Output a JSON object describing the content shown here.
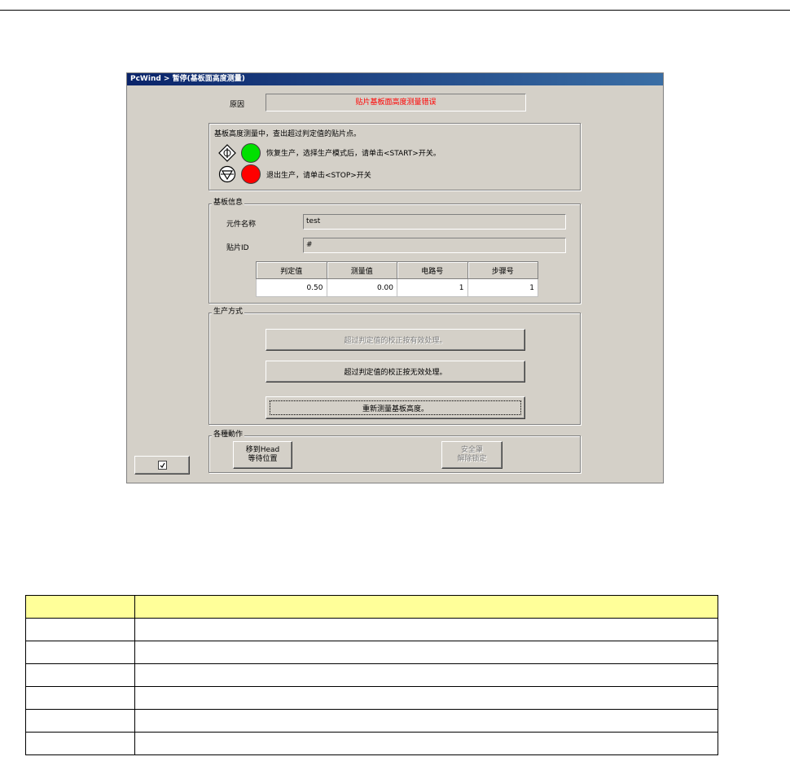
{
  "window": {
    "title": "PcWind > 暂停(基板面高度测量)"
  },
  "reason": {
    "label": "原因",
    "value": "贴片基板面高度测量错误"
  },
  "message": {
    "text": "基板高度测量中，查出超过判定值的贴片点。",
    "resume_text": "恢复生产，选择生产模式后，请单击<START>开关。",
    "stop_text": "退出生产，请单击<STOP>开关"
  },
  "board_info": {
    "title": "基板信息",
    "component_label": "元件名称",
    "component_value": "test",
    "mount_id_label": "贴片ID",
    "mount_id_value": "#",
    "table": {
      "headers": [
        "判定值",
        "测量值",
        "电路号",
        "步骤号"
      ],
      "row": [
        "0.50",
        "0.00",
        "1",
        "1"
      ]
    }
  },
  "production_mode": {
    "title": "生产方式",
    "option1": "超过判定值的校正按有效处理。",
    "option2": "超过判定值的校正按无效处理。",
    "option3": "重新测量基板高度。"
  },
  "actions": {
    "title": "各種動作",
    "move_head": "移到Head\n等待位置",
    "safety": "安全罩\n解除锁定"
  },
  "doc_table": {
    "rows": 7
  },
  "colors": {
    "title_bar": "#0a246a",
    "reason_text": "#ff0000",
    "green_lamp": "#00e000",
    "red_lamp": "#ff0000",
    "table_header": "#ffff99"
  }
}
